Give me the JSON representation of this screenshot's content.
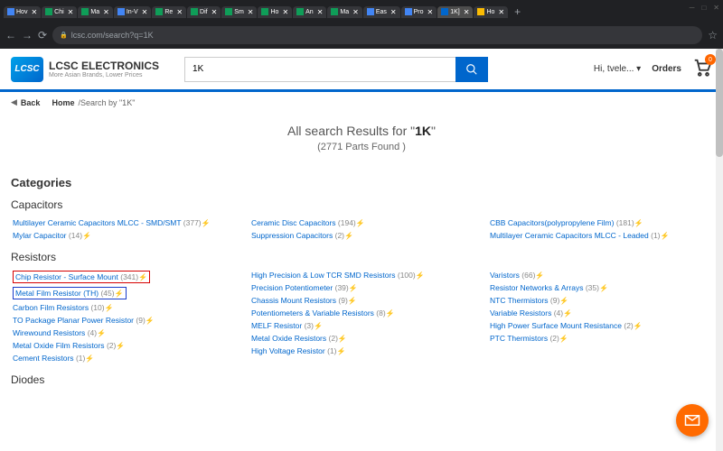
{
  "browser": {
    "tabs": [
      "Hov",
      "Chi",
      "Ma",
      "In-V",
      "Re",
      "Dif",
      "Sm",
      "Ho",
      "An",
      "Ma",
      "Eas",
      "Pro",
      "1K]",
      "Ho"
    ],
    "url": "lcsc.com/search?q=1K"
  },
  "header": {
    "logo_name": "LCSC ELECTRONICS",
    "logo_tag": "More Asian Brands, Lower Prices",
    "search_value": "1K",
    "hi_user": "Hi, tvele...",
    "orders": "Orders",
    "cart_count": "0"
  },
  "breadcrumb": {
    "back": "Back",
    "home": "Home",
    "path": "/Search by \"1K\""
  },
  "results": {
    "title_prefix": "All search Results for \"",
    "title_term": "1K",
    "title_suffix": "\"",
    "count": "(2771 Parts Found )"
  },
  "labels": {
    "categories": "Categories",
    "capacitors": "Capacitors",
    "resistors": "Resistors",
    "diodes": "Diodes"
  },
  "capacitors": [
    [
      {
        "label": "Multilayer Ceramic Capacitors MLCC - SMD/SMT",
        "count": "(377)"
      },
      {
        "label": "Mylar Capacitor",
        "count": "(14)"
      }
    ],
    [
      {
        "label": "Ceramic Disc Capacitors",
        "count": "(194)"
      },
      {
        "label": "Suppression Capacitors",
        "count": "(2)"
      }
    ],
    [
      {
        "label": "CBB Capacitors(polypropylene Film)",
        "count": "(181)"
      },
      {
        "label": "Multilayer Ceramic Capacitors MLCC - Leaded",
        "count": "(1)"
      }
    ]
  ],
  "resistors": [
    [
      {
        "label": "Chip Resistor - Surface Mount",
        "count": "(341)",
        "hl": "red"
      },
      {
        "label": "Metal Film Resistor (TH)",
        "count": "(45)",
        "hl": "blue"
      },
      {
        "label": "Carbon Film Resistors",
        "count": "(10)"
      },
      {
        "label": "TO Package Planar Power Resistor",
        "count": "(9)"
      },
      {
        "label": "Wirewound Resistors",
        "count": "(4)"
      },
      {
        "label": "Metal Oxide Film Resistors",
        "count": "(2)"
      },
      {
        "label": "Cement Resistors",
        "count": "(1)"
      }
    ],
    [
      {
        "label": "High Precision & Low TCR SMD Resistors",
        "count": "(100)"
      },
      {
        "label": "Precision Potentiometer",
        "count": "(39)"
      },
      {
        "label": "Chassis Mount Resistors",
        "count": "(9)"
      },
      {
        "label": "Potentiometers & Variable Resistors",
        "count": "(8)"
      },
      {
        "label": "MELF Resistor",
        "count": "(3)"
      },
      {
        "label": "Metal Oxide Resistors",
        "count": "(2)"
      },
      {
        "label": "High Voltage Resistor",
        "count": "(1)"
      }
    ],
    [
      {
        "label": "Varistors",
        "count": "(66)"
      },
      {
        "label": "Resistor Networks & Arrays",
        "count": "(35)"
      },
      {
        "label": "NTC Thermistors",
        "count": "(9)"
      },
      {
        "label": "Variable Resistors",
        "count": "(4)"
      },
      {
        "label": "High Power Surface Mount Resistance",
        "count": "(2)"
      },
      {
        "label": "PTC Thermistors",
        "count": "(2)"
      }
    ]
  ]
}
